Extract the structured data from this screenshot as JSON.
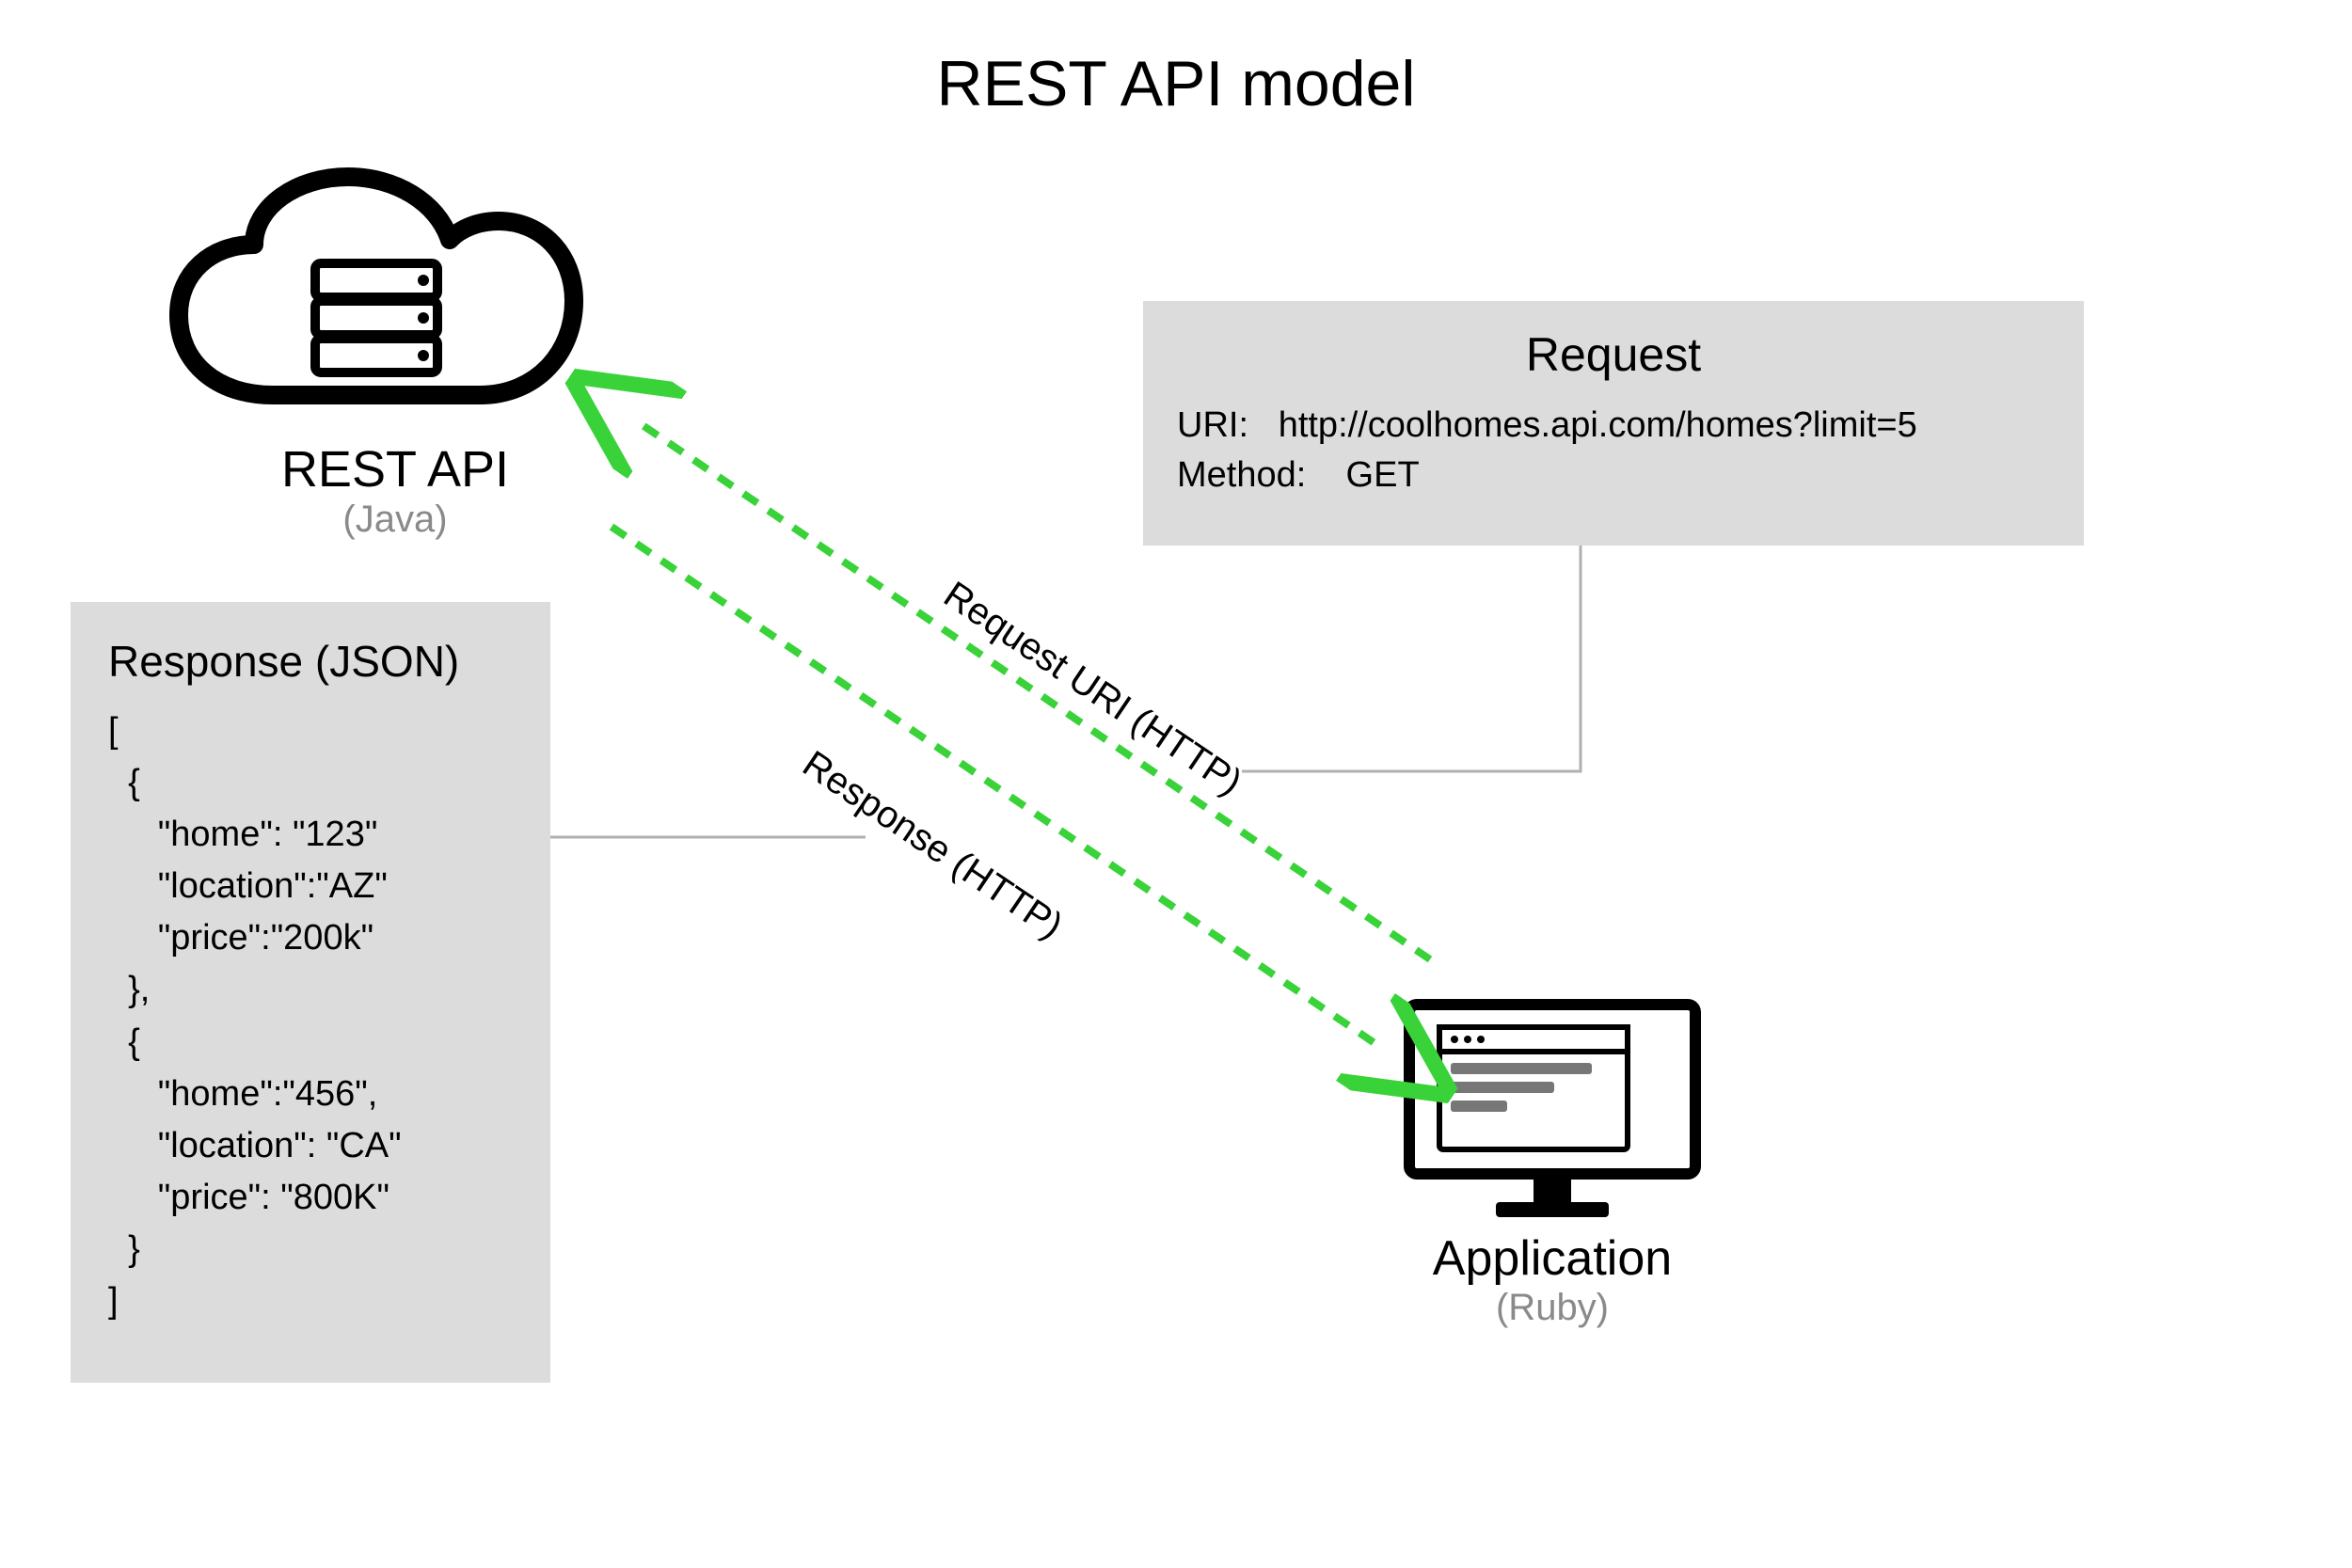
{
  "title": "REST API model",
  "rest_api": {
    "label": "REST API",
    "sublabel": "(Java)"
  },
  "application": {
    "label": "Application",
    "sublabel": "(Ruby)"
  },
  "request": {
    "heading": "Request",
    "uri_label": "URI:",
    "uri_value": "http://coolhomes.api.com/homes?limit=5",
    "method_label": "Method:",
    "method_value": "GET"
  },
  "response": {
    "heading": "Response (JSON)",
    "body": "[\n  {\n     \"home\": \"123\"\n     \"location\":\"AZ\"\n     \"price\":\"200k\"\n  },\n  {\n     \"home\":\"456\",\n     \"location\": \"CA\"\n     \"price\": \"800K\"\n  }\n]"
  },
  "arrows": {
    "request_label": "Request URI (HTTP)",
    "response_label": "Response (HTTP)"
  },
  "colors": {
    "arrow_green": "#39d339",
    "panel_grey": "#dcdcdc",
    "connector_grey": "#b0b0b0"
  }
}
